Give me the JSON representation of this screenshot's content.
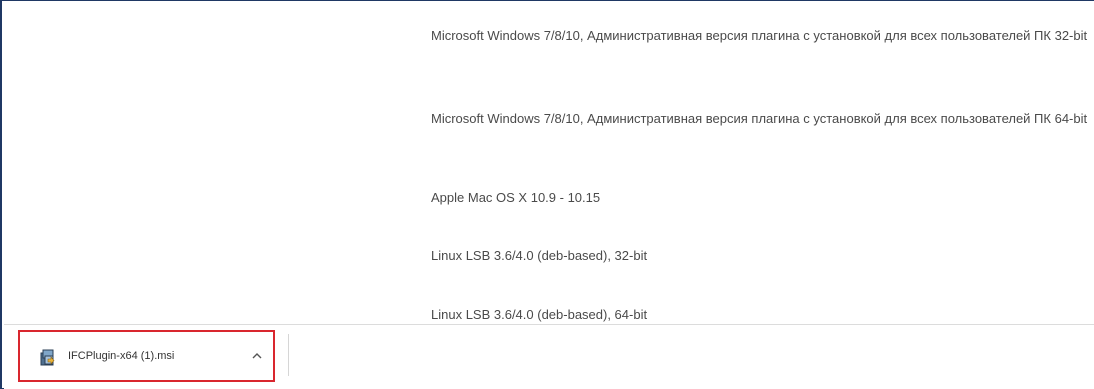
{
  "download_links": [
    {
      "label": "Microsoft Windows 7/8/10, Административная версия плагина с установкой для всех пользователей ПК 32-bit"
    },
    {
      "label": "Microsoft Windows 7/8/10, Административная версия плагина с установкой для всех пользователей ПК 64-bit"
    },
    {
      "label": "Apple Mac OS X 10.9 - 10.15"
    },
    {
      "label": "Linux LSB 3.6/4.0 (deb-based), 32-bit"
    },
    {
      "label": "Linux LSB 3.6/4.0 (deb-based), 64-bit"
    }
  ],
  "download_bar": {
    "file_name": "IFCPlugin-x64 (1).msi",
    "file_icon": "msi-installer-icon",
    "menu_icon": "chevron-up-icon",
    "highlight_color": "#d9262e"
  }
}
